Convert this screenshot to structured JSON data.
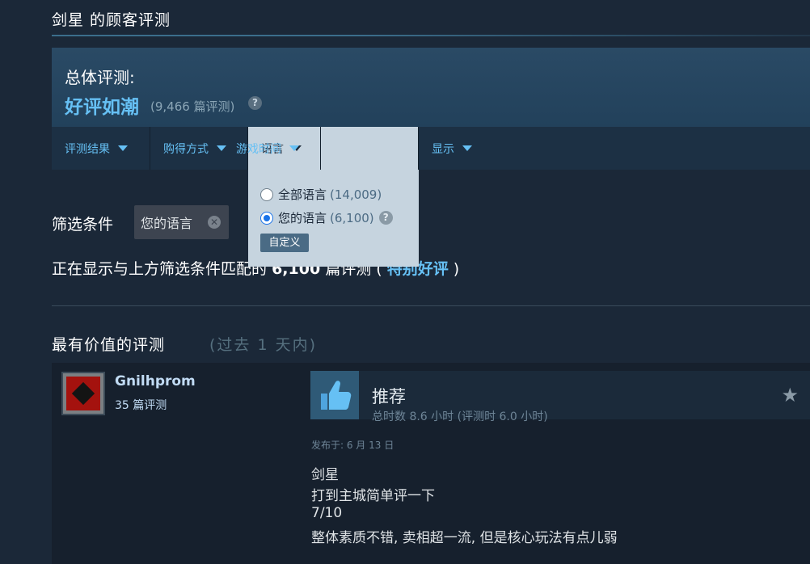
{
  "section_title": "剑星 的顾客评测",
  "summary": {
    "label": "总体评测:",
    "score": "好评如潮",
    "count": "(9,466 篇评测)",
    "help_icon": "question-icon"
  },
  "filters": [
    {
      "label": "评测结果",
      "active": false
    },
    {
      "label": "购得方式",
      "active": false
    },
    {
      "label": "语言",
      "active": true
    },
    {
      "label": "游戏时间",
      "active": false
    },
    {
      "label": "显示",
      "active": false
    }
  ],
  "language_dropdown": {
    "options": [
      {
        "label": "全部语言",
        "count": "(14,009)",
        "selected": false
      },
      {
        "label": "您的语言",
        "count": "(6,100)",
        "selected": true
      }
    ],
    "custom_button": "自定义"
  },
  "active_filters": {
    "label": "筛选条件",
    "chip": "您的语言"
  },
  "showing": {
    "prefix": "正在显示与上方筛选条件匹配的",
    "count": "6,100",
    "mid": "篇评测 (",
    "rating": "特别好评",
    "suffix": ")"
  },
  "helpful": {
    "title": "最有价值的评测",
    "subtitle": "(过去 1 天内)"
  },
  "review": {
    "author": "Gnilhprom",
    "author_reviews": "35 篇评测",
    "verdict": "推荐",
    "hours": "总时数 8.6 小时 (评测时 6.0 小时)",
    "posted": "发布于: 6 月 13 日",
    "lines": [
      "剑星",
      "打到主城简单评一下",
      "7/10",
      "整体素质不错, 卖相超一流, 但是核心玩法有点儿弱"
    ]
  },
  "colors": {
    "background": "#1b2838",
    "accent": "#66c0f4",
    "dropdown": "#c6d4df"
  }
}
